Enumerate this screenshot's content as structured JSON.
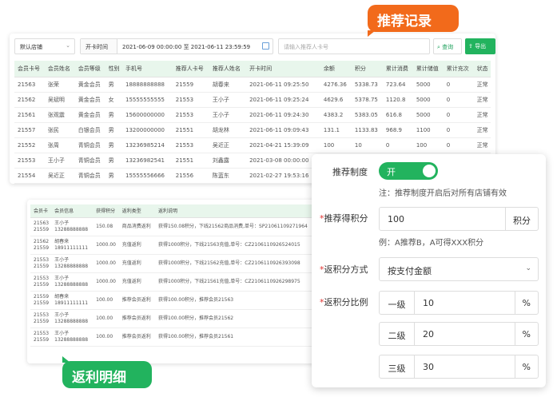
{
  "callouts": {
    "recommend": "推荐记录",
    "rebate_detail": "返利明细"
  },
  "toolbar": {
    "store_select": "默认店铺",
    "time_label": "开卡时间",
    "time_range": "2021-06-09 00:00:00 至 2021-06-11 23:59:59",
    "search_placeholder": "请输入推荐人卡号",
    "search_label": "查询",
    "export_label": "导出",
    "icons": {
      "calendar": "calendar-icon",
      "search": "search-icon",
      "export": "export-icon"
    }
  },
  "members": {
    "columns": [
      "会员卡号",
      "会员姓名",
      "会员等级",
      "性别",
      "手机号",
      "推荐人卡号",
      "推荐人姓名",
      "开卡时间",
      "余额",
      "积分",
      "累计消费",
      "累计储值",
      "累计充次",
      "状态"
    ],
    "rows": [
      [
        "21563",
        "张荣",
        "黄金会员",
        "男",
        "18888888888",
        "21559",
        "胡春来",
        "2021-06-11 09:25:50",
        "4276.36",
        "5338.73",
        "723.64",
        "5000",
        "0",
        "正常"
      ],
      [
        "21562",
        "吴斌明",
        "黄金会员",
        "女",
        "15555555555",
        "21553",
        "王小子",
        "2021-06-11 09:25:24",
        "4629.6",
        "5378.75",
        "1120.8",
        "5000",
        "0",
        "正常"
      ],
      [
        "21561",
        "张观震",
        "黄金会员",
        "男",
        "15600000000",
        "21553",
        "王小子",
        "2021-06-11 09:24:30",
        "4383.2",
        "5383.05",
        "616.8",
        "5000",
        "0",
        "正常"
      ],
      [
        "21557",
        "张民",
        "白银会员",
        "男",
        "13200000000",
        "21551",
        "胡龙林",
        "2021-06-11 09:09:43",
        "131.1",
        "1133.83",
        "968.9",
        "1100",
        "0",
        "正常"
      ],
      [
        "21552",
        "张周",
        "青铜会员",
        "男",
        "13236985214",
        "21553",
        "吴近正",
        "2021-04-21 15:39:09",
        "100",
        "10",
        "0",
        "100",
        "0",
        "正常"
      ],
      [
        "21553",
        "王小子",
        "青铜会员",
        "男",
        "13236982541",
        "21551",
        "刘鑫露",
        "2021-03-08 00:00:00",
        "",
        "",
        "",
        "",
        "",
        ""
      ],
      [
        "21554",
        "吴近正",
        "青铜会员",
        "男",
        "15555556666",
        "21556",
        "陈蓝东",
        "2021-02-27 19:53:16",
        "",
        "",
        "",
        "",
        "",
        ""
      ]
    ]
  },
  "rebates": {
    "columns": [
      "会员卡",
      "会员信息",
      "获得积分",
      "返利类型",
      "返利说明"
    ],
    "rows": [
      [
        "21563\n21559",
        "王小子\n13288888888",
        "150.08",
        "商品消费返利",
        "获得150.08积分，下线21562商品消费,单号：SP21061109271964"
      ],
      [
        "21562\n21559",
        "胡春来\n18911111111",
        "1000.00",
        "充值返利",
        "获得1000积分，下线21563充值,单号：CZ2106110926524015"
      ],
      [
        "21553\n21559",
        "王小子\n13288888888",
        "1000.00",
        "充值返利",
        "获得1000积分，下线21562充值,单号：CZ2106110926393098"
      ],
      [
        "21553\n21559",
        "王小子\n13288888888",
        "1000.00",
        "充值返利",
        "获得1000积分，下线21561充值,单号：CZ2106110926298975"
      ],
      [
        "21559\n21559",
        "胡春来\n18911111111",
        "100.00",
        "推荐会员返利",
        "获得100.00积分，推荐会员21563"
      ],
      [
        "21553\n21559",
        "王小子\n13288888888",
        "100.00",
        "推荐会员返利",
        "获得100.00积分，推荐会员21562"
      ],
      [
        "21553\n21559",
        "王小子\n13288888888",
        "100.00",
        "推荐会员返利",
        "获得100.00积分，推荐会员21561"
      ]
    ]
  },
  "settings": {
    "system_label": "推荐制度",
    "system_toggle": "开",
    "system_note": "注：推荐制度开启后对所有店铺有效",
    "points_label": "推荐得积分",
    "points_value": "100",
    "points_suffix": "积分",
    "points_example": "例：A推荐B，A可得XXX积分",
    "method_label": "返积分方式",
    "method_value": "按支付金额",
    "ratio_label": "返积分比例",
    "ratio_levels": [
      {
        "name": "一级",
        "value": "10",
        "unit": "%"
      },
      {
        "name": "二级",
        "value": "20",
        "unit": "%"
      },
      {
        "name": "三级",
        "value": "30",
        "unit": "%"
      }
    ],
    "colors": {
      "accent": "#22b35e",
      "callout": "#f26a1b",
      "required": "#e0322f"
    }
  }
}
